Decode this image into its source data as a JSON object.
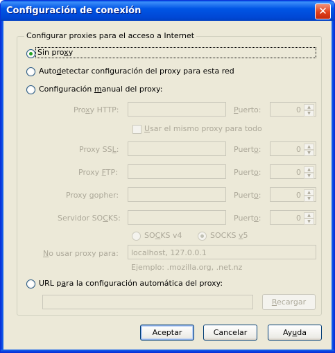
{
  "window": {
    "title": "Configuración de conexión",
    "close_glyph": "✕"
  },
  "group": {
    "legend": "Configurar proxies para el acceso a Internet"
  },
  "radios": {
    "none": {
      "pre": "Sin pro",
      "ul": "x",
      "post": "y",
      "checked": true
    },
    "autodetect": {
      "pre": "Auto",
      "ul": "d",
      "post": "etectar configuración del proxy para esta red",
      "checked": false
    },
    "manual": {
      "pre": "Configuración ",
      "ul": "m",
      "post": "anual del proxy:",
      "checked": false
    },
    "auto_url": {
      "pre": "URL p",
      "ul": "a",
      "post": "ra la configuración automática del proxy:",
      "checked": false
    }
  },
  "manual": {
    "http": {
      "pre": "Pro",
      "ul": "x",
      "post": "y HTTP:",
      "port_pre": "",
      "port_ul": "P",
      "port_post": "uerto:",
      "port": "0"
    },
    "same_proxy": {
      "pre": "",
      "ul": "U",
      "post": "sar el mismo proxy para todo"
    },
    "ssl": {
      "pre": "Proxy SS",
      "ul": "L",
      "post": ":",
      "port_pre": "Puert",
      "port_ul": "o",
      "port_post": ":",
      "port": "0"
    },
    "ftp": {
      "pre": "Proxy ",
      "ul": "F",
      "post": "TP:",
      "port_pre": "Puert",
      "port_ul": "o",
      "port_post": ":",
      "port": "0"
    },
    "gopher": {
      "pre": "Proxy ",
      "ul": "g",
      "post": "opher:",
      "port_pre": "Puert",
      "port_ul": "o",
      "port_post": ":",
      "port": "0"
    },
    "socks": {
      "pre": "Servidor SO",
      "ul": "C",
      "post": "KS:",
      "port_pre": "Puert",
      "port_ul": "o",
      "port_post": ":",
      "port": "0"
    },
    "socks_v4": {
      "pre": "SO",
      "ul": "C",
      "post": "KS v4",
      "checked": false
    },
    "socks_v5": {
      "pre": "SOCKS ",
      "ul": "v",
      "post": "5",
      "checked": true
    },
    "no_proxy": {
      "pre": "",
      "ul": "N",
      "post": "o usar proxy para:",
      "value": "localhost, 127.0.0.1"
    },
    "example": "Ejemplo: .mozilla.org, .net.nz"
  },
  "auto_url": {
    "value": "",
    "reload_pre": "",
    "reload_ul": "R",
    "reload_post": "ecargar"
  },
  "buttons": {
    "ok": "Aceptar",
    "cancel": "Cancelar",
    "help": {
      "pre": "Ay",
      "ul": "u",
      "post": "da"
    }
  }
}
